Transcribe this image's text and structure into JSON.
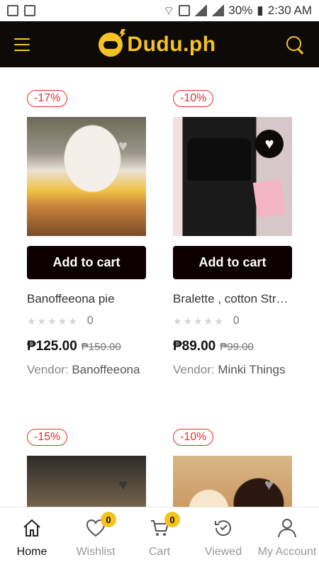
{
  "status_bar": {
    "battery": "30%",
    "time": "2:30 AM"
  },
  "header": {
    "brand": "Dudu.ph"
  },
  "products": [
    {
      "discount": "-17%",
      "add_label": "Add to cart",
      "name": "Banoffeeona pie",
      "rating": "0",
      "price": "₱125.00",
      "old_price": "₱150.00",
      "vendor_label": "Vendor:",
      "vendor": "Banoffeeona"
    },
    {
      "discount": "-10%",
      "add_label": "Add to cart",
      "name": "Bralette , cotton Stretch",
      "rating": "0",
      "price": "₱89.00",
      "old_price": "₱99.00",
      "vendor_label": "Vendor:",
      "vendor": "Minki Things"
    },
    {
      "discount": "-15%"
    },
    {
      "discount": "-10%"
    }
  ],
  "nav": {
    "home": "Home",
    "wishlist": "Wishlist",
    "wishlist_count": "0",
    "cart": "Cart",
    "cart_count": "0",
    "viewed": "Viewed",
    "account": "My Account"
  }
}
